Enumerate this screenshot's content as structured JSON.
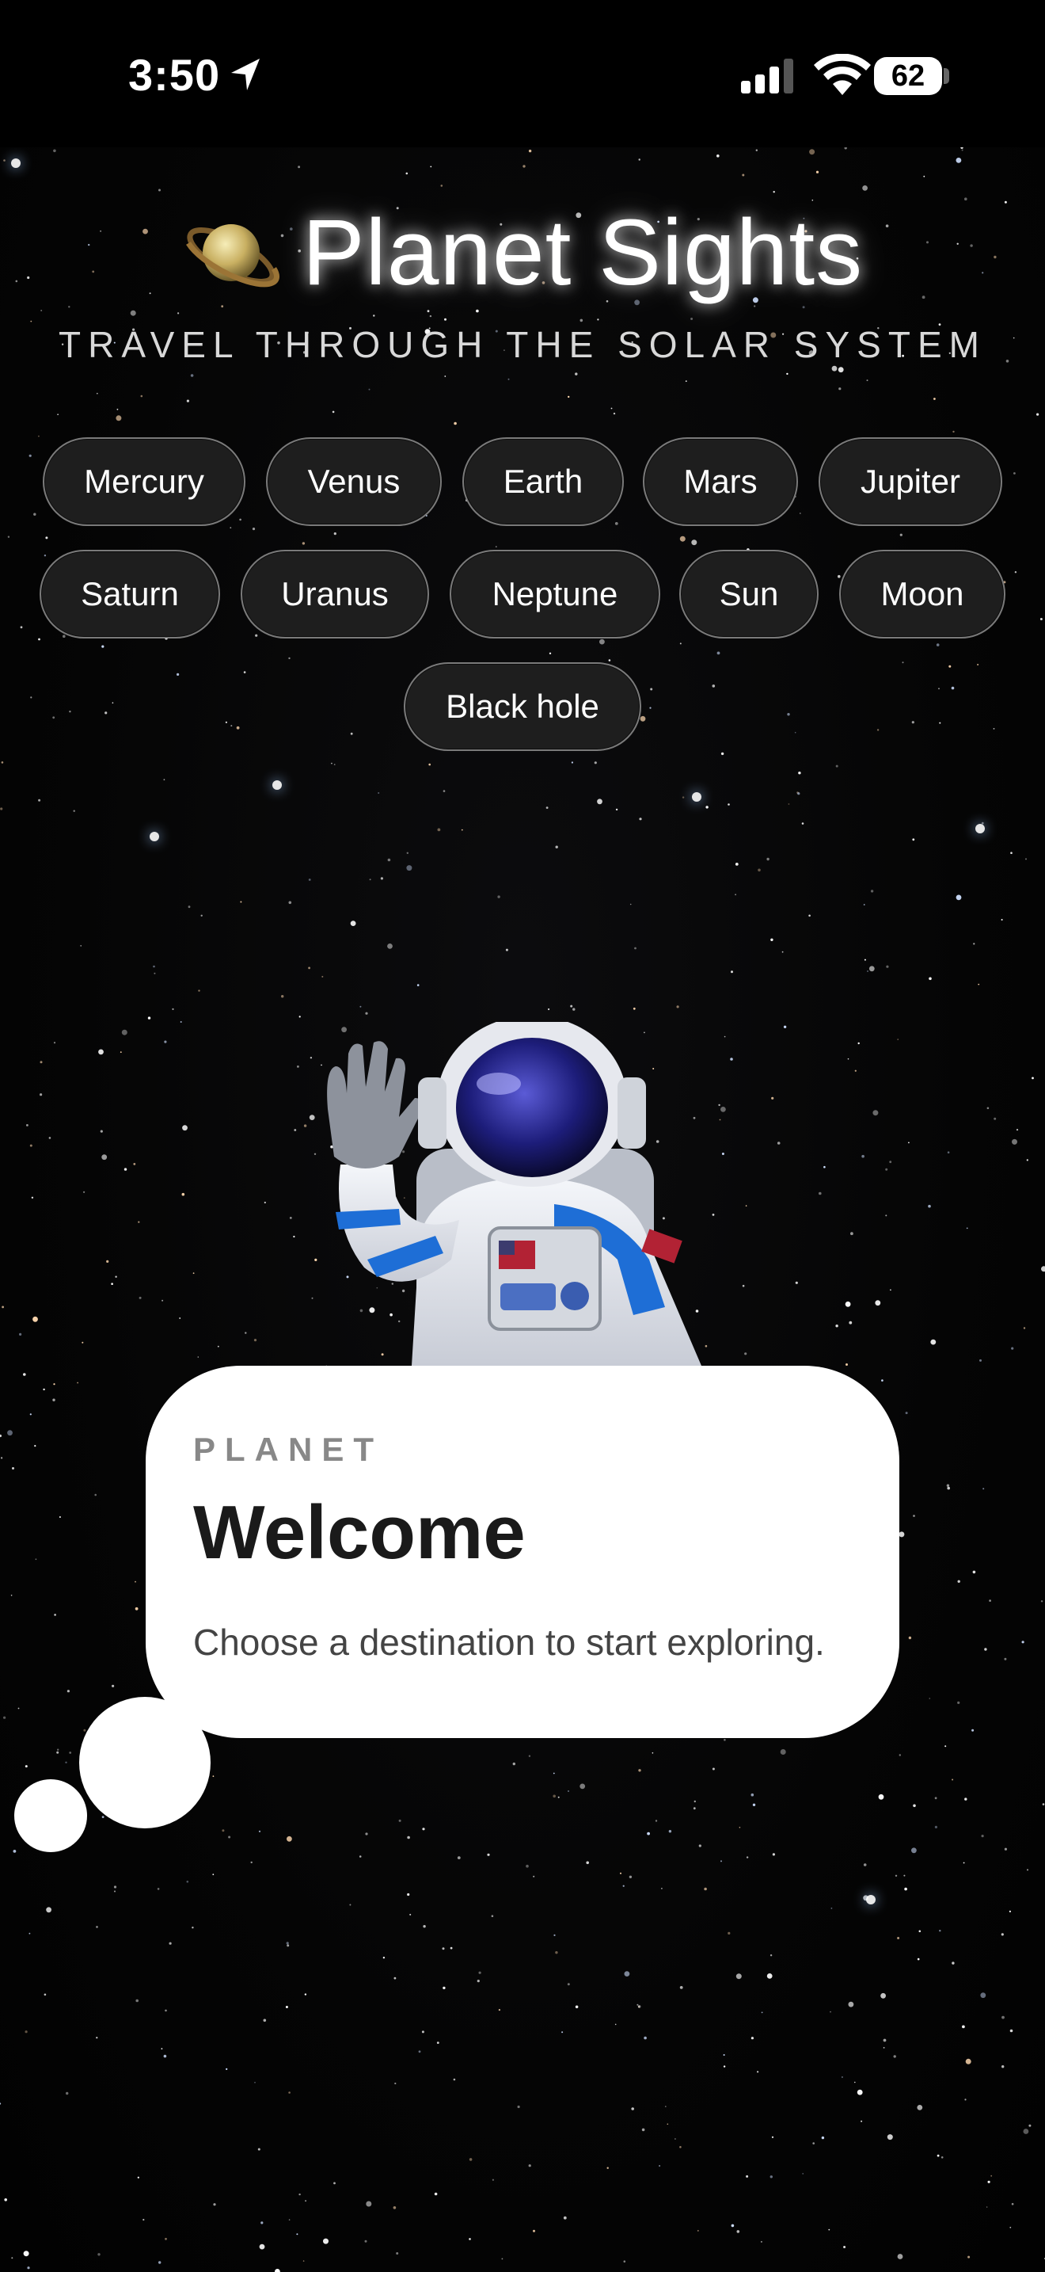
{
  "status_bar": {
    "time": "3:50",
    "battery": "62"
  },
  "app": {
    "title": "Planet Sights",
    "subtitle": "TRAVEL THROUGH THE SOLAR SYSTEM"
  },
  "destinations": [
    "Mercury",
    "Venus",
    "Earth",
    "Mars",
    "Jupiter",
    "Saturn",
    "Uranus",
    "Neptune",
    "Sun",
    "Moon",
    "Black hole"
  ],
  "card": {
    "label": "PLANET",
    "title": "Welcome",
    "description": "Choose a destination to start exploring."
  },
  "icons": {
    "location": "location-arrow-icon",
    "signal": "cellular-signal-icon",
    "wifi": "wifi-icon",
    "app_logo": "saturn-icon",
    "mascot": "astronaut-illustration"
  },
  "colors": {
    "background": "#000000",
    "chip_background": "#1e1e1e",
    "chip_border": "#7a7a7a",
    "card_background": "#ffffff"
  }
}
